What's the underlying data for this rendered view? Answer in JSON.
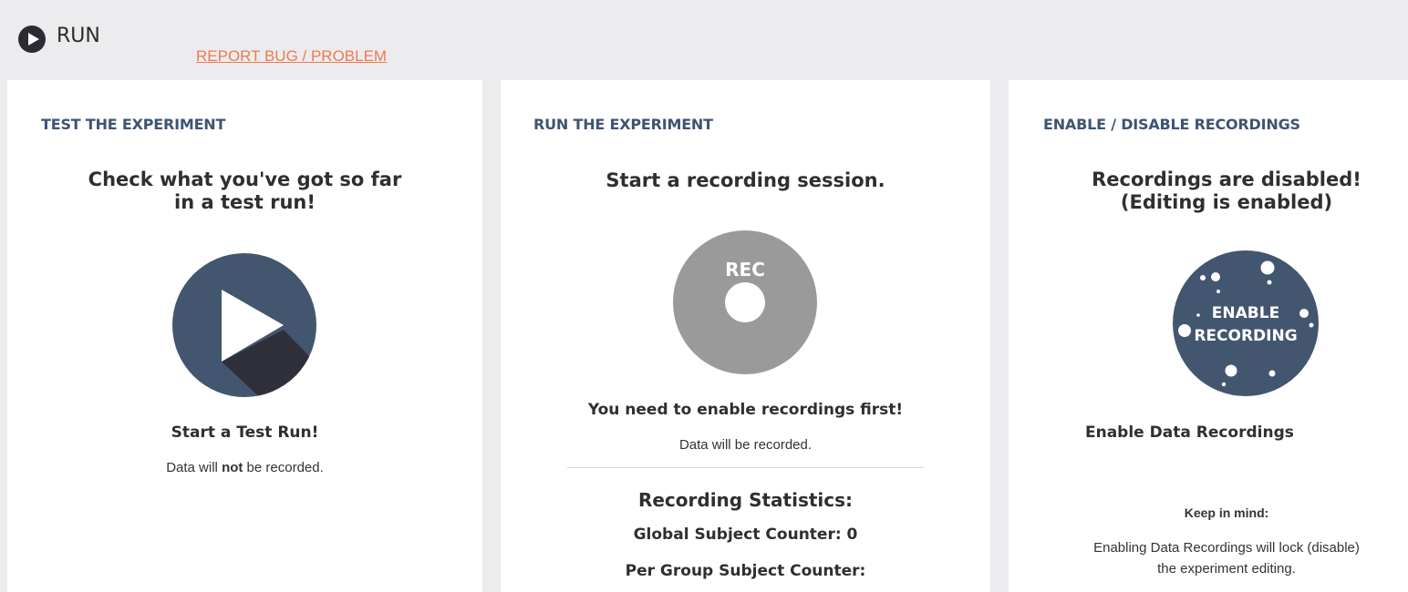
{
  "header": {
    "title": "RUN",
    "report_link": "REPORT BUG / PROBLEM",
    "icon": "play-circle-icon"
  },
  "test_panel": {
    "heading": "TEST THE EXPERIMENT",
    "description": "Check what you've got so far in a test run!",
    "button_icon": "play-icon",
    "action_label": "Start a Test Run!",
    "note_prefix": "Data will ",
    "note_emphasis": "not",
    "note_suffix": " be recorded."
  },
  "run_panel": {
    "heading": "RUN THE EXPERIMENT",
    "description": "Start a recording session.",
    "button_label": "REC",
    "warning": "You need to enable recordings first!",
    "note": "Data will be recorded.",
    "stats_title": "Recording Statistics:",
    "global_counter_label": "Global Subject Counter: 0",
    "group_counter_label": "Per Group Subject Counter:"
  },
  "recordings_panel": {
    "heading": "ENABLE / DISABLE RECORDINGS",
    "status_line1": "Recordings are disabled!",
    "status_line2": "(Editing is enabled)",
    "button_line1": "ENABLE",
    "button_line2": "RECORDING",
    "action_label": "Enable Data Recordings",
    "keep_in_mind": "Keep in mind:",
    "warning_line1": "Enabling Data Recordings will lock (disable)",
    "warning_line2": "the experiment editing."
  },
  "colors": {
    "background": "#ececee",
    "navy": "#43566f",
    "dark_shadow": "#2f2f3a",
    "rec_gray": "#9a9a9a",
    "heading": "#3e5472",
    "link": "#f07a50"
  }
}
